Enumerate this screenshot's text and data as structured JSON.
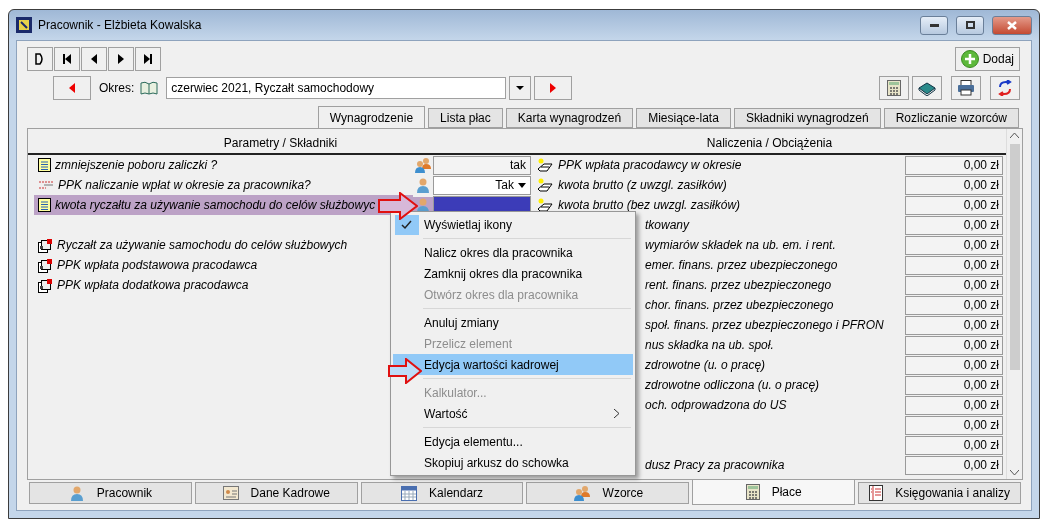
{
  "window": {
    "title": "Pracownik - Elżbieta Kowalska"
  },
  "add_button": "Dodaj",
  "period": {
    "label": "Okres:",
    "value": "czerwiec 2021, Ryczałt samochodowy"
  },
  "tabs": [
    {
      "label": "Wynagrodzenie",
      "selected": true
    },
    {
      "label": "Lista płac",
      "selected": false
    },
    {
      "label": "Karta wynagrodzeń",
      "selected": false
    },
    {
      "label": "Miesiące-lata",
      "selected": false
    },
    {
      "label": "Składniki wynagrodzeń",
      "selected": false
    },
    {
      "label": "Rozliczanie wzorców",
      "selected": false
    }
  ],
  "left_header": "Parametry / Składniki",
  "right_header": "Naliczenia / Obciążenia",
  "parameters": [
    {
      "kind": "text",
      "label": "zmniejszenie poboru zaliczki ?",
      "value": "tak",
      "selected": false
    },
    {
      "kind": "dropdown",
      "label": "PPK naliczanie wpłat w okresie za pracownika?",
      "value": "Tak",
      "selected": false
    },
    {
      "kind": "text",
      "label": "kwota ryczałtu za używanie samochodu do celów służbowyc",
      "selected": true
    }
  ],
  "elements": [
    "Ryczałt za używanie samochodu do celów służbowych",
    "PPK wpłata podstawowa pracodawca",
    "PPK wpłata dodatkowa pracodawca"
  ],
  "charges": [
    {
      "label": "PPK wpłata pracodawcy w okresie",
      "value": "0,00 zł",
      "covered": false
    },
    {
      "label": "kwota brutto (z uwzgl. zasiłków)",
      "value": "0,00 zł",
      "covered": false
    },
    {
      "label": "kwota brutto (bez uwzgl. zasiłków)",
      "value": "0,00 zł",
      "covered": false
    },
    {
      "label": "tkowany",
      "value": "0,00 zł",
      "covered": true
    },
    {
      "label": "wymiarów składek na ub. em. i rent.",
      "value": "0,00 zł",
      "covered": true
    },
    {
      "label": "emer. finans. przez ubezpieczonego",
      "value": "0,00 zł",
      "covered": true
    },
    {
      "label": "rent. finans. przez ubezpieczonego",
      "value": "0,00 zł",
      "covered": true
    },
    {
      "label": "chor. finans. przez ubezpieczonego",
      "value": "0,00 zł",
      "covered": true
    },
    {
      "label": "społ. finans. przez ubezpieczonego i PFRON",
      "value": "0,00 zł",
      "covered": true
    },
    {
      "label": "nus składka na ub. społ.",
      "value": "0,00 zł",
      "covered": true
    },
    {
      "label": "zdrowotne (u. o pracę)",
      "value": "0,00 zł",
      "covered": true
    },
    {
      "label": "zdrowotne odliczona (u. o pracę)",
      "value": "0,00 zł",
      "covered": true
    },
    {
      "label": "och. odprowadzona do US",
      "value": "0,00 zł",
      "covered": true
    },
    {
      "value": "0,00 zł"
    },
    {
      "value": "0,00 zł"
    },
    {
      "label": "dusz Pracy za pracownika",
      "value": "0,00 zł",
      "covered": true
    }
  ],
  "context_menu": [
    {
      "kind": "item",
      "label": "Wyświetlaj ikony",
      "checked": true,
      "disabled": false,
      "selected": false
    },
    {
      "kind": "separator"
    },
    {
      "kind": "item",
      "label": "Nalicz okres dla pracownika",
      "checked": false,
      "disabled": false,
      "selected": false
    },
    {
      "kind": "item",
      "label": "Zamknij okres dla pracownika",
      "checked": false,
      "disabled": false,
      "selected": false
    },
    {
      "kind": "item",
      "label": "Otwórz okres dla pracownika",
      "checked": false,
      "disabled": true,
      "selected": false
    },
    {
      "kind": "separator"
    },
    {
      "kind": "item",
      "label": "Anuluj zmiany",
      "checked": false,
      "disabled": false,
      "selected": false
    },
    {
      "kind": "item",
      "label": "Przelicz element",
      "checked": false,
      "disabled": true,
      "selected": false
    },
    {
      "kind": "item",
      "label": "Edycja wartości kadrowej",
      "checked": false,
      "disabled": false,
      "selected": true
    },
    {
      "kind": "separator"
    },
    {
      "kind": "item",
      "label": "Kalkulator...",
      "checked": false,
      "disabled": true,
      "selected": false
    },
    {
      "kind": "submenu",
      "label": "Wartość",
      "checked": false,
      "disabled": false,
      "selected": false
    },
    {
      "kind": "separator"
    },
    {
      "kind": "item",
      "label": "Edycja elementu...",
      "checked": false,
      "disabled": false,
      "selected": false
    },
    {
      "kind": "item",
      "label": "Skopiuj arkusz do schowka",
      "checked": false,
      "disabled": false,
      "selected": false
    }
  ],
  "bottom_tabs": [
    {
      "kind": "person",
      "label": "Pracownik",
      "selected": false
    },
    {
      "kind": "card",
      "label": "Dane Kadrowe",
      "selected": false
    },
    {
      "kind": "calendar",
      "label": "Kalendarz",
      "selected": false
    },
    {
      "kind": "people",
      "label": "Wzorce",
      "selected": false
    },
    {
      "kind": "calculator",
      "label": "Płace",
      "selected": true
    },
    {
      "kind": "ledger",
      "label": "Księgowania i analizy",
      "selected": false
    }
  ]
}
